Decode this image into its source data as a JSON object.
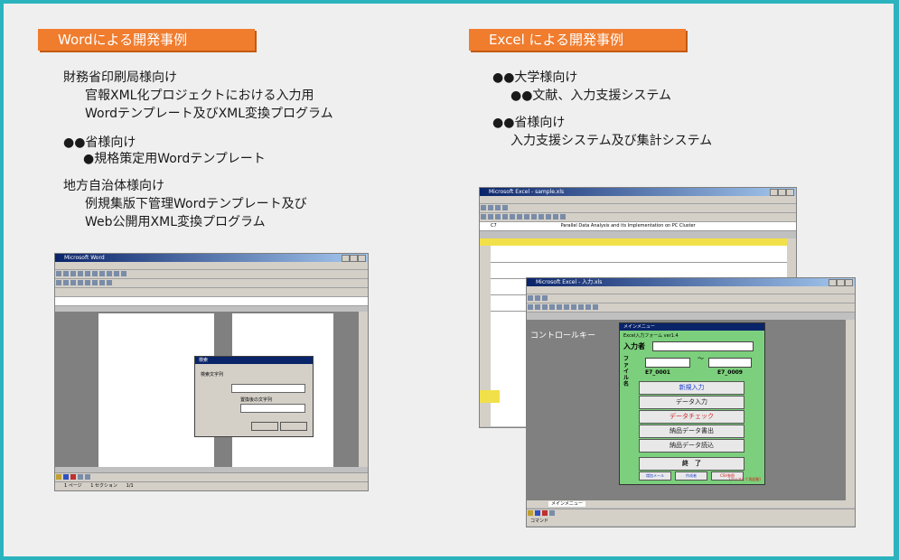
{
  "left": {
    "section_title": "Wordによる開発事例",
    "items": [
      {
        "org": "財務省印刷局様向け",
        "lines": [
          "官報XML化プロジェクトにおける入力用",
          "Wordテンプレート及びXML変換プログラム"
        ]
      },
      {
        "org": "●●省様向け",
        "lines": [
          "●規格策定用Wordテンプレート"
        ]
      },
      {
        "org": "地方自治体様向け",
        "lines": [
          "例規集版下管理Wordテンプレート及び",
          "Web公開用XML変換プログラム"
        ]
      }
    ]
  },
  "right": {
    "section_title": "Excel による開発事例",
    "items": [
      {
        "org": "●●大学様向け",
        "lines": [
          "●●文献、入力支援システム"
        ]
      },
      {
        "org": "●●省様向け",
        "lines": [
          "入力支援システム及び集計システム"
        ]
      }
    ]
  },
  "word_shot": {
    "title": "Microsoft Word",
    "dialog": {
      "title": "検索",
      "labels": [
        "検索文字列",
        "置換後の文字列"
      ]
    },
    "status": [
      "1 ページ",
      "1 セクション",
      "1/1"
    ]
  },
  "excel_shot_back": {
    "title": "Microsoft Excel - sample.xls",
    "cell_ref": "C7",
    "formula": "Parallel Data Analysis and its Implementation on PC Cluster"
  },
  "excel_shot_front": {
    "title": "Microsoft Excel - 入力.xls",
    "control_key": "コントロールキー",
    "menu": {
      "title": "メインメニュー",
      "subtitle": "Excel入力フォーム ver1.4",
      "input_label": "入力者",
      "file_label": "ファイル名",
      "tilde": "～",
      "range_from": "E7_0001",
      "range_to": "E7_0009",
      "buttons": [
        "新規入力",
        "データ入力",
        "データチェック",
        "納品データ書出",
        "納品データ読込"
      ],
      "exit_label": "終　了",
      "small_buttons": [
        "増加メール",
        "作成者",
        "CSV参照"
      ],
      "footer": "(クリアして再起動)"
    },
    "sheet_tab": "メインメニュー",
    "status": "コマンド"
  }
}
